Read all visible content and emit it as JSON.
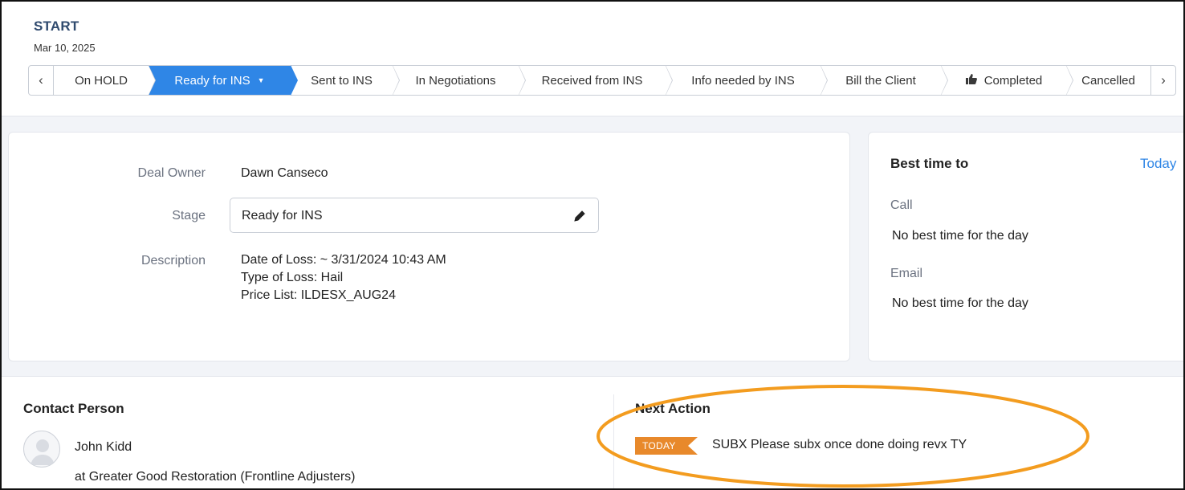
{
  "header": {
    "start_label": "START",
    "start_date": "Mar 10, 2025"
  },
  "stages": {
    "prev_icon": "chevron-left-icon",
    "next_icon": "chevron-right-icon",
    "items": [
      {
        "label": "On HOLD",
        "active": false
      },
      {
        "label": "Ready for INS",
        "active": true
      },
      {
        "label": "Sent to INS",
        "active": false
      },
      {
        "label": "In Negotiations",
        "active": false
      },
      {
        "label": "Received from INS",
        "active": false
      },
      {
        "label": "Info needed by INS",
        "active": false
      },
      {
        "label": "Bill the Client",
        "active": false
      },
      {
        "label": "Completed",
        "active": false,
        "icon": "thumbs-up-icon"
      },
      {
        "label": "Cancelled",
        "active": false
      }
    ],
    "active_color": "#2f86e6"
  },
  "details": {
    "deal_owner_label": "Deal Owner",
    "deal_owner_value": "Dawn Canseco",
    "stage_label": "Stage",
    "stage_value": "Ready for INS",
    "description_label": "Description",
    "description_lines": [
      "Date of Loss: ~ 3/31/2024 10:43 AM",
      "Type of Loss: Hail",
      "Price List: ILDESX_AUG24"
    ]
  },
  "best_time": {
    "title": "Best time to",
    "today_link": "Today",
    "call_label": "Call",
    "call_value": "No best time for the day",
    "email_label": "Email",
    "email_value": "No best time for the day"
  },
  "contact": {
    "title": "Contact Person",
    "name": "John Kidd",
    "company": "at Greater Good Restoration (Frontline Adjusters)"
  },
  "next_action": {
    "title": "Next Action",
    "tag": "TODAY",
    "tag_color": "#e8892b",
    "text": "SUBX Please subx once done doing revx TY"
  },
  "annotation": {
    "highlight_color": "#f39c1f"
  }
}
